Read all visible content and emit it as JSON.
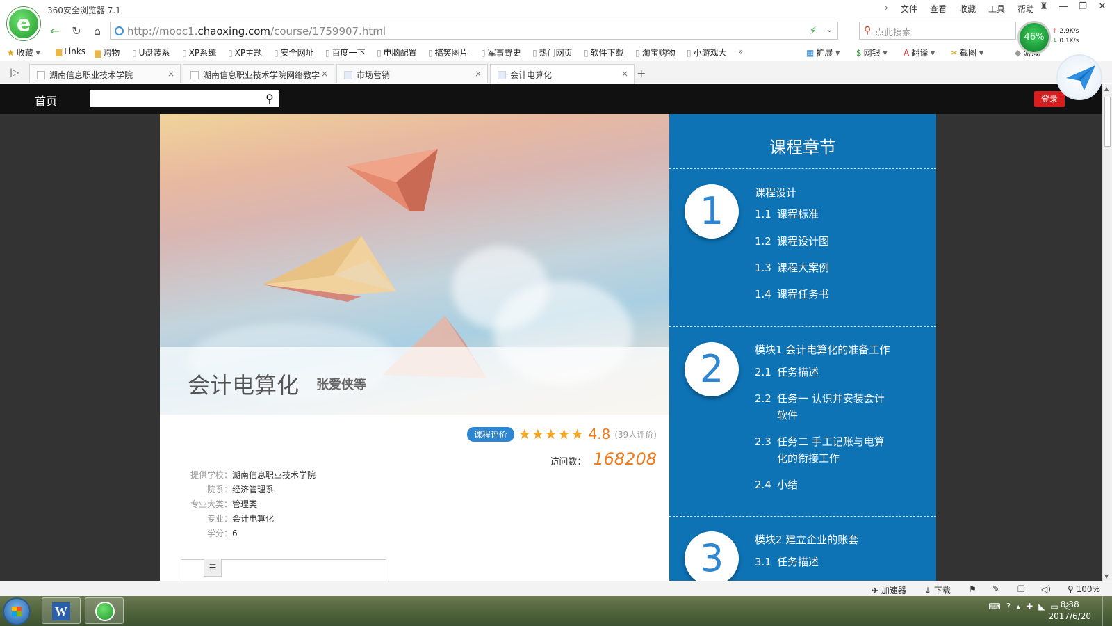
{
  "browser": {
    "app_title": "360安全浏览器 7.1",
    "menu": [
      "文件",
      "查看",
      "收藏",
      "工具",
      "帮助"
    ],
    "address": {
      "prefix": "http://mooc1.",
      "domain": "chaoxing.com",
      "path": "/course/1759907.html"
    },
    "search_placeholder": "点此搜索",
    "net": {
      "gauge": "46%",
      "up": "2.9K/s",
      "down": "0.1K/s"
    },
    "bookmarks": [
      {
        "label": "收藏",
        "icon": "star-icon"
      },
      {
        "label": "Links",
        "icon": "folder-icon"
      },
      {
        "label": "购物",
        "icon": "folder-icon"
      },
      {
        "label": "U盘装系",
        "icon": "page-icon"
      },
      {
        "label": "XP系统",
        "icon": "page-icon"
      },
      {
        "label": "XP主题",
        "icon": "page-icon"
      },
      {
        "label": "安全网址",
        "icon": "page-icon"
      },
      {
        "label": "百度一下",
        "icon": "page-icon"
      },
      {
        "label": "电脑配置",
        "icon": "page-icon"
      },
      {
        "label": "搞笑图片",
        "icon": "page-icon"
      },
      {
        "label": "军事野史",
        "icon": "page-icon"
      },
      {
        "label": "热门网页",
        "icon": "page-icon"
      },
      {
        "label": "软件下载",
        "icon": "page-icon"
      },
      {
        "label": "淘宝购物",
        "icon": "page-icon"
      },
      {
        "label": "小游戏大",
        "icon": "page-icon"
      }
    ],
    "bookmarks_more": "»",
    "tools": [
      {
        "label": "扩展",
        "icon": "extensions-icon"
      },
      {
        "label": "网银",
        "icon": "bank-icon"
      },
      {
        "label": "翻译",
        "icon": "translate-icon"
      },
      {
        "label": "截图",
        "icon": "screenshot-icon"
      },
      {
        "label": "游戏",
        "icon": "game-icon"
      }
    ],
    "tabs": [
      {
        "label": "湖南信息职业技术学院"
      },
      {
        "label": "湖南信息职业技术学院网络教学"
      },
      {
        "label": "市场营销"
      },
      {
        "label": "会计电算化"
      }
    ],
    "status": {
      "accelerator": "加速器",
      "download": "下载",
      "zoom": "100%"
    }
  },
  "site": {
    "nav_home": "首页",
    "search_value": "",
    "login": "登录"
  },
  "course": {
    "title": "会计电算化",
    "teacher": "张爱侠等",
    "rate_badge": "课程评价",
    "stars": "★★★★★",
    "score": "4.8",
    "rate_count": "(39人评价)",
    "visits_label": "访问数：",
    "visits": "168208",
    "info": [
      {
        "label": "提供学校：",
        "value": "湖南信息职业技术学院"
      },
      {
        "label": "院系：",
        "value": "经济管理系"
      },
      {
        "label": "专业大类：",
        "value": "管理类"
      },
      {
        "label": "专业：",
        "value": "会计电算化"
      },
      {
        "label": "学分：",
        "value": "6"
      }
    ]
  },
  "chapters": {
    "title": "课程章节",
    "units": [
      {
        "num": "1",
        "title": "课程设计",
        "items": [
          {
            "n": "1.1",
            "t": "课程标准"
          },
          {
            "n": "1.2",
            "t": "课程设计图"
          },
          {
            "n": "1.3",
            "t": "课程大案例"
          },
          {
            "n": "1.4",
            "t": "课程任务书"
          }
        ]
      },
      {
        "num": "2",
        "title": "模块1 会计电算化的准备工作",
        "items": [
          {
            "n": "2.1",
            "t": "任务描述"
          },
          {
            "n": "2.2",
            "t": "任务一 认识并安装会计软件"
          },
          {
            "n": "2.3",
            "t": "任务二 手工记账与电算化的衔接工作"
          },
          {
            "n": "2.4",
            "t": "小结"
          }
        ]
      },
      {
        "num": "3",
        "title": "模块2 建立企业的账套",
        "items": [
          {
            "n": "3.1",
            "t": "任务描述"
          }
        ]
      }
    ]
  },
  "taskbar": {
    "time": "8:38",
    "date": "2017/6/20"
  }
}
